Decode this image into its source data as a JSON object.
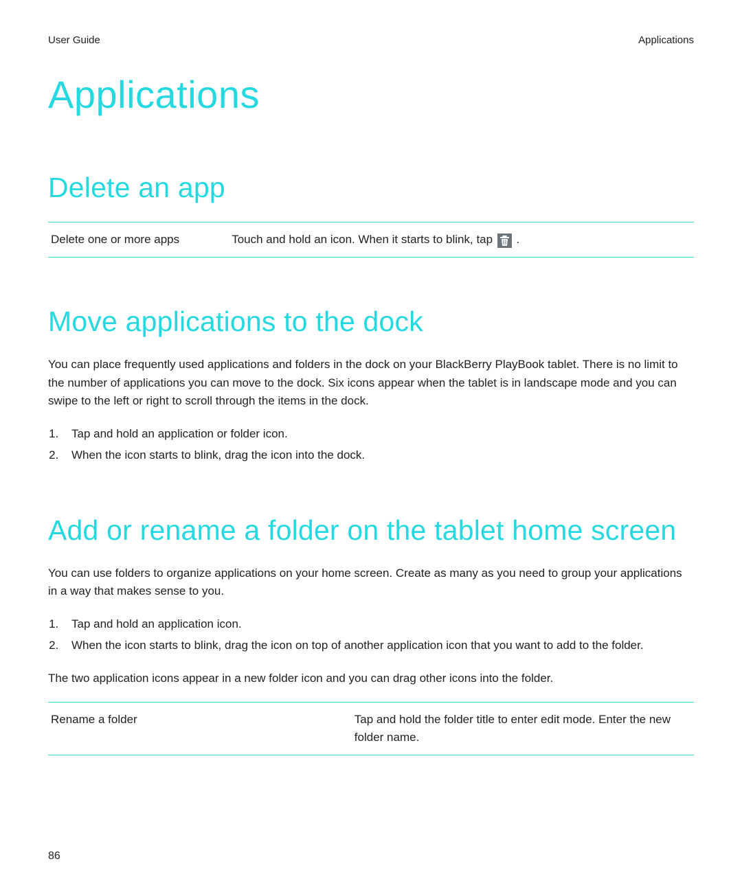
{
  "header": {
    "left": "User Guide",
    "right": "Applications"
  },
  "title": "Applications",
  "sections": {
    "delete": {
      "heading": "Delete an app",
      "row_label": "Delete one or more apps",
      "row_text_before": "Touch and hold an icon. When it starts to blink, tap ",
      "row_text_after": " ."
    },
    "move": {
      "heading": "Move applications to the dock",
      "intro": "You can place frequently used applications and folders in the dock on your BlackBerry PlayBook tablet. There is no limit to the number of applications you can move to the dock. Six icons appear when the tablet is in landscape mode and you can swipe to the left or right to scroll through the items in the dock.",
      "steps": [
        "Tap and hold an application or folder icon.",
        "When the icon starts to blink, drag the icon into the dock."
      ]
    },
    "folder": {
      "heading": "Add or rename a folder on the tablet home screen",
      "intro": "You can use folders to organize applications on your home screen. Create as many as you need to group your applications in a way that makes sense to you.",
      "steps": [
        "Tap and hold an application icon.",
        "When the icon starts to blink, drag the icon on top of another application icon that you want to add to the folder."
      ],
      "after_steps": "The two application icons appear in a new folder icon and you can drag other icons into the folder.",
      "row_label": "Rename a folder",
      "row_text": "Tap and hold the folder title to enter edit mode. Enter the new folder name."
    }
  },
  "page_number": "86"
}
